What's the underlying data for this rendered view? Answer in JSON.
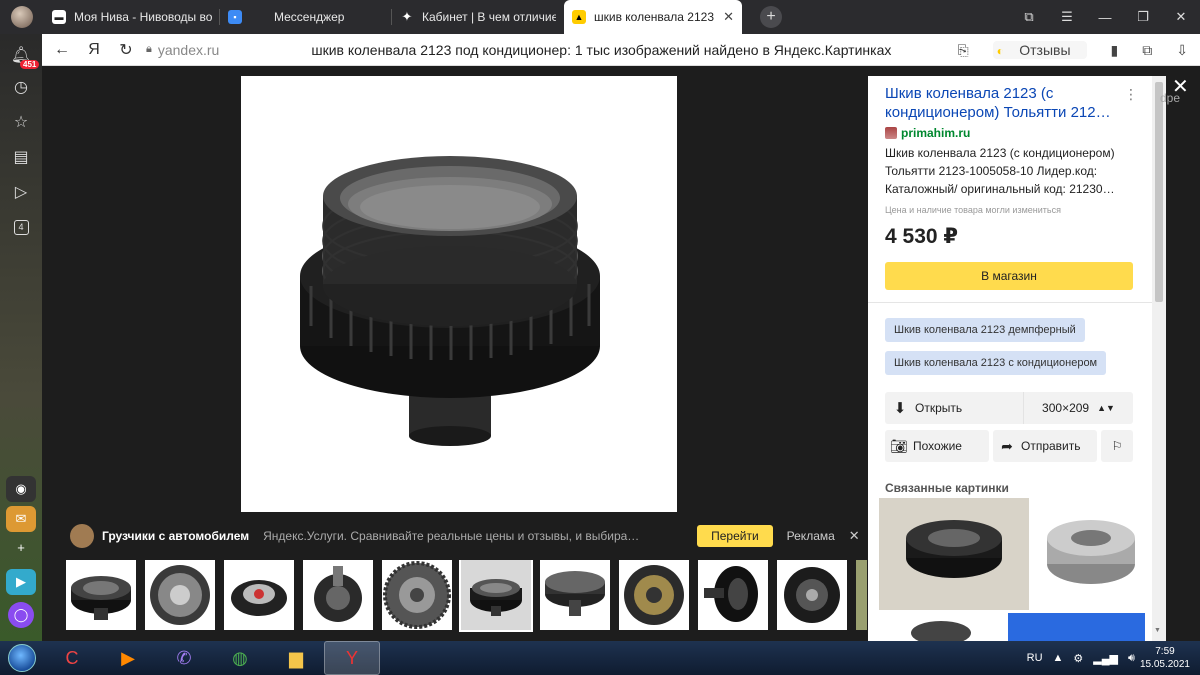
{
  "browser": {
    "tabs": [
      {
        "label": "Моя Нива - Нивоводы во",
        "icon": "car-icon"
      },
      {
        "label": "Мессенджер",
        "icon": "messenger-icon"
      },
      {
        "label": "Кабинет | В чем отличие",
        "icon": "sparkle-icon"
      },
      {
        "label": "шкив коленвала 2123 п",
        "icon": "yandex-images-icon",
        "active": true
      }
    ],
    "notification_count": "451",
    "collections_count": "4",
    "host": "yandex.ru",
    "page_title": "шкив коленвала 2123 под кондиционер: 1 тыс изображений найдено в Яндекс.Картинках",
    "reviews_label": "Отзывы"
  },
  "ad": {
    "title": "Грузчики с автомобилем",
    "description": "Яндекс.Услуги. Сравнивайте реальные цены и отзывы, и выбирайте...",
    "go_label": "Перейти",
    "ad_label": "Реклама"
  },
  "panel": {
    "title": "Шкив коленвала 2123 (с кондиционером) Тольятти 212…",
    "site": "primahim.ru",
    "description": "Шкив коленвала 2123 (с кондиционером) Тольятти 2123-1005058-10 Лидер.код: Каталожный/ оригинальный код: 21230…",
    "note": "Цена и наличие товара могли измениться",
    "price": "4 530 ₽",
    "shop_label": "В магазин",
    "chips": [
      "Шкив коленвала 2123 демпферный",
      "Шкив коленвала 2123 с кондиционером"
    ],
    "open_label": "Открыть",
    "size": "300×209",
    "similar_label": "Похожие",
    "share_label": "Отправить",
    "related_title": "Связанные картинки"
  },
  "side_text": "dpe",
  "taskbar": {
    "lang": "RU",
    "time": "7:59",
    "date": "15.05.2021"
  }
}
